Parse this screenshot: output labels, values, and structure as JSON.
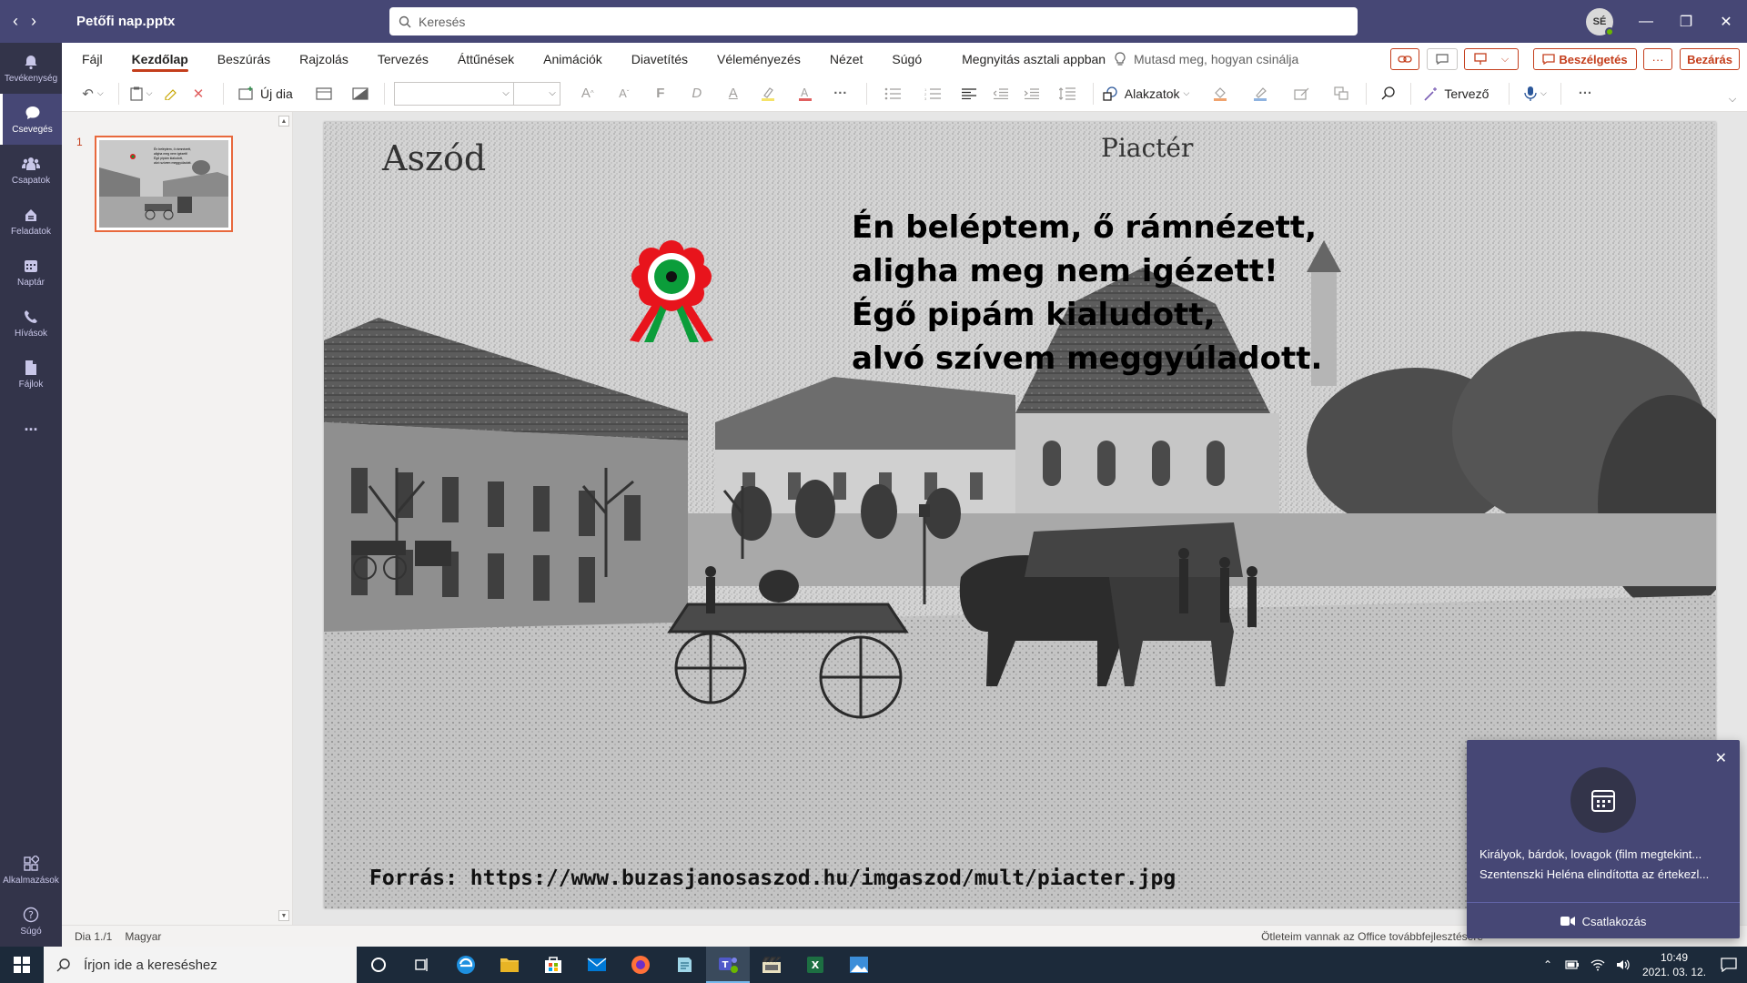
{
  "window": {
    "title": "Petőfi nap.pptx",
    "search_placeholder": "Keresés",
    "avatar_initials": "SÉ"
  },
  "rail": {
    "items": [
      {
        "label": "Tevékenység",
        "icon": "bell-icon"
      },
      {
        "label": "Csevegés",
        "icon": "chat-icon"
      },
      {
        "label": "Csapatok",
        "icon": "teams-icon"
      },
      {
        "label": "Feladatok",
        "icon": "assignments-icon"
      },
      {
        "label": "Naptár",
        "icon": "calendar-icon"
      },
      {
        "label": "Hívások",
        "icon": "phone-icon"
      },
      {
        "label": "Fájlok",
        "icon": "file-icon"
      }
    ],
    "more": "...",
    "apps": "Alkalmazások",
    "help": "Súgó"
  },
  "ribbon": {
    "tabs": [
      "Fájl",
      "Kezdőlap",
      "Beszúrás",
      "Rajzolás",
      "Tervezés",
      "Áttűnések",
      "Animációk",
      "Diavetítés",
      "Véleményezés",
      "Nézet",
      "Súgó",
      "Megnyitás asztali appban"
    ],
    "tellme": "Mutasd meg, hogyan csinálja",
    "chat_button": "Beszélgetés",
    "close_button": "Bezárás",
    "more": "···"
  },
  "toolbar": {
    "new_slide": "Új dia",
    "shapes": "Alakzatok",
    "designer": "Tervező",
    "bold": "F",
    "italic": "D",
    "underline": "A",
    "font_grow": "A",
    "font_shrink": "A",
    "more": "···"
  },
  "thumbnails": {
    "slide_number": "1"
  },
  "slide": {
    "caption_left": "Aszód",
    "caption_right": "Piactér",
    "poem_lines": [
      "Én beléptem, ő rámnézett,",
      "aligha meg nem igézett!",
      "Égő pipám kialudott,",
      "alvó szívem meggyúladott."
    ],
    "source": "Forrás: https://www.buzasjanosaszod.hu/imgaszod/mult/piacter.jpg"
  },
  "status": {
    "slide_info": "Dia 1./1",
    "language": "Magyar",
    "feedback": "Ötleteim vannak az Office továbbfejlesztésére"
  },
  "toast": {
    "title": "Királyok, bárdok, lovagok (film megtekint...",
    "subtitle": "Szentenszki Heléna elindította az értekezl...",
    "join": "Csatlakozás"
  },
  "taskbar": {
    "search_placeholder": "Írjon ide a kereséshez",
    "time": "10:49",
    "date": "2021. 03. 12."
  },
  "colors": {
    "teams_purple": "#464775",
    "rail_dark": "#33344a",
    "ppt_accent": "#c43e1c",
    "cockade_red": "#e8141c",
    "cockade_green": "#0b9d3a"
  }
}
